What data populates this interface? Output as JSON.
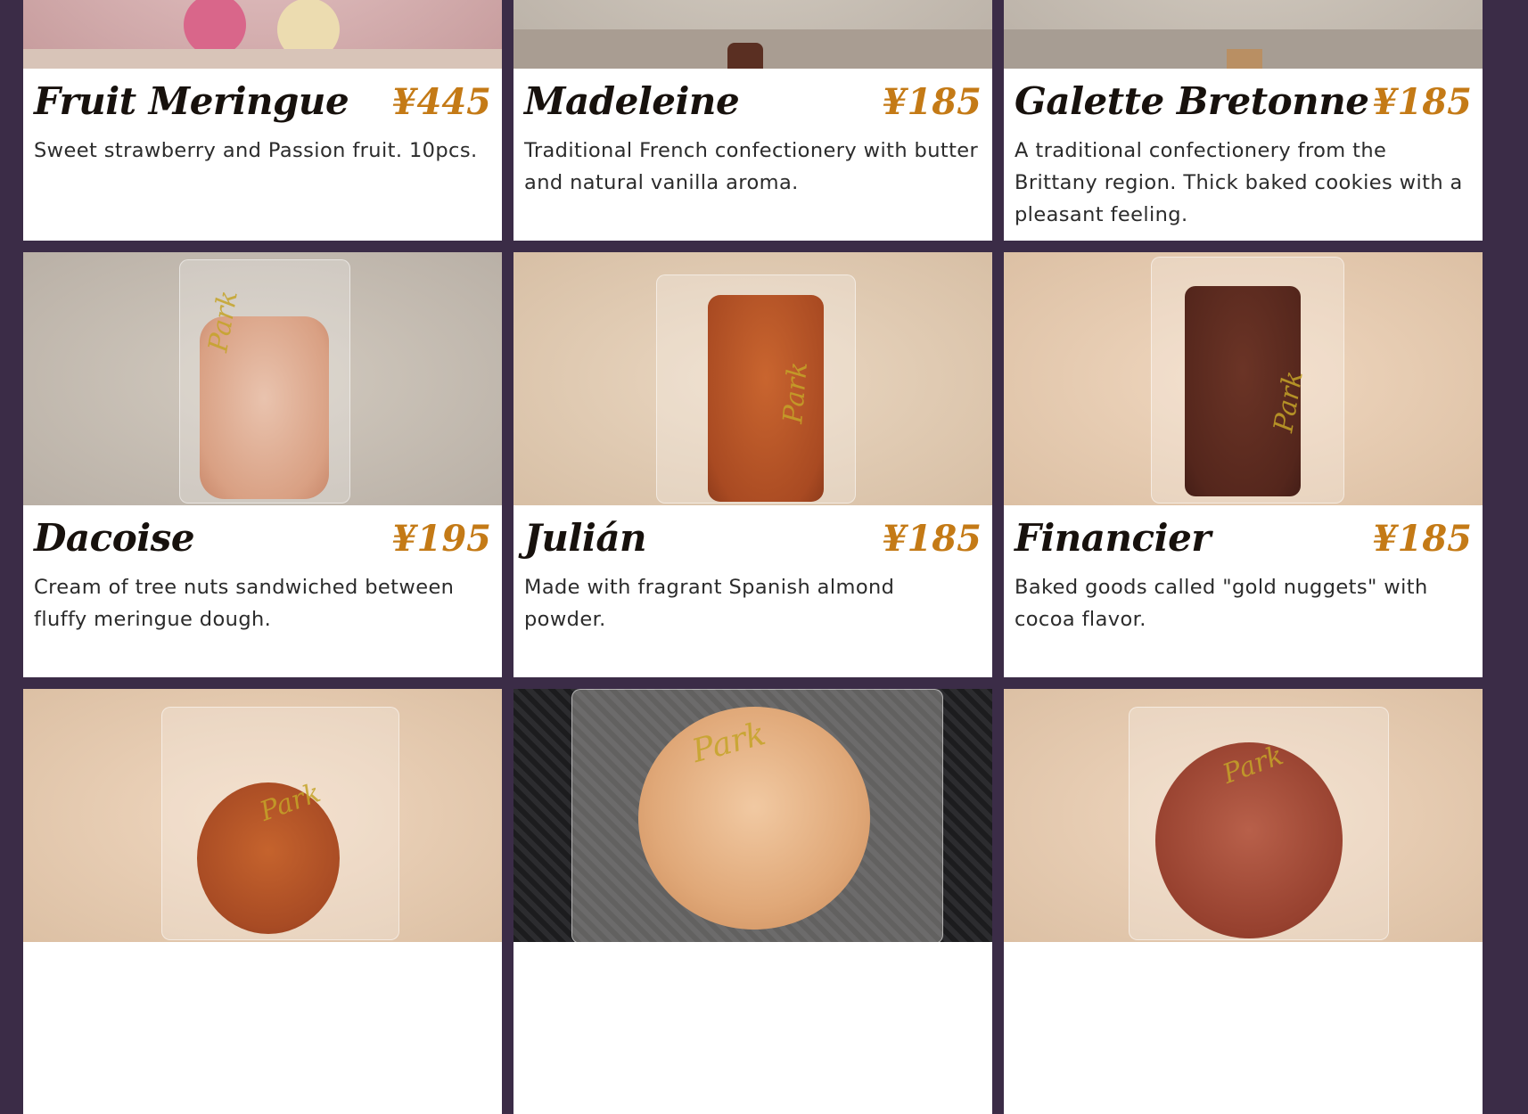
{
  "products": [
    {
      "name": "Fruit Meringue",
      "price": "¥445",
      "description": "Sweet strawberry and Passion fruit. 10pcs."
    },
    {
      "name": "Madeleine",
      "price": "¥185",
      "description": "Traditional French confectionery with butter and natural vanilla aroma."
    },
    {
      "name": "Galette Bretonne",
      "price": "¥185",
      "description": "A traditional confectionery from the Brittany region. Thick baked cookies with a pleasant feeling."
    },
    {
      "name": "Dacoise",
      "price": "¥195",
      "description": "Cream of tree nuts sandwiched between fluffy meringue dough."
    },
    {
      "name": "Julián",
      "price": "¥185",
      "description": "Made with fragrant Spanish almond powder."
    },
    {
      "name": "Financier",
      "price": "¥185",
      "description": "Baked goods called \"gold nuggets\" with cocoa flavor."
    },
    {
      "name": "",
      "price": "",
      "description": ""
    },
    {
      "name": "",
      "price": "",
      "description": ""
    },
    {
      "name": "",
      "price": "",
      "description": ""
    }
  ],
  "colors": {
    "page_background": "#3b2c47",
    "card_background": "#ffffff",
    "price": "#c47a16",
    "title": "#17110d"
  }
}
